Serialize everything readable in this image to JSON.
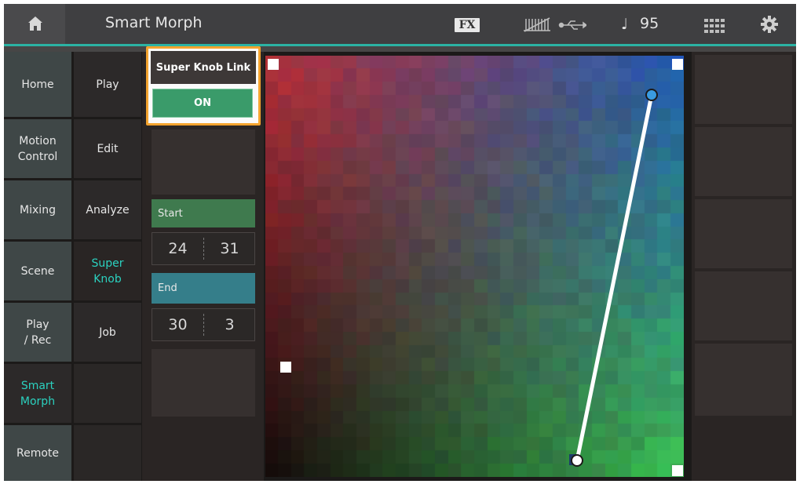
{
  "header": {
    "title": "Smart Morph",
    "fx_label": "FX",
    "tempo": "95",
    "accent_color": "#2bb3a4"
  },
  "nav_primary": [
    {
      "label": "Home",
      "active": false
    },
    {
      "label": "Motion\nControl",
      "active": false
    },
    {
      "label": "Mixing",
      "active": false
    },
    {
      "label": "Scene",
      "active": false
    },
    {
      "label": "Play\n/ Rec",
      "active": false
    },
    {
      "label": "Smart\nMorph",
      "active": true
    },
    {
      "label": "Remote",
      "active": false
    }
  ],
  "nav_secondary": [
    {
      "label": "Play",
      "active": false
    },
    {
      "label": "Edit",
      "active": false
    },
    {
      "label": "Analyze",
      "active": false
    },
    {
      "label": "Super\nKnob",
      "active": true
    },
    {
      "label": "Job",
      "active": false
    },
    {
      "label": "",
      "active": false
    },
    {
      "label": "",
      "active": false
    }
  ],
  "super_knob_link": {
    "title": "Super Knob Link",
    "value": "ON"
  },
  "start": {
    "label": "Start",
    "x": "24",
    "y": "31"
  },
  "end": {
    "label": "End",
    "x": "30",
    "y": "3"
  },
  "map": {
    "grid_size": 32,
    "colors": {
      "top_left": "#b8303a",
      "top_right": "#1f5cae",
      "bottom_left": "#120808",
      "bottom_right": "#3ebd55",
      "start_marker": "#ffffff",
      "end_marker": "#3a9be0"
    }
  }
}
